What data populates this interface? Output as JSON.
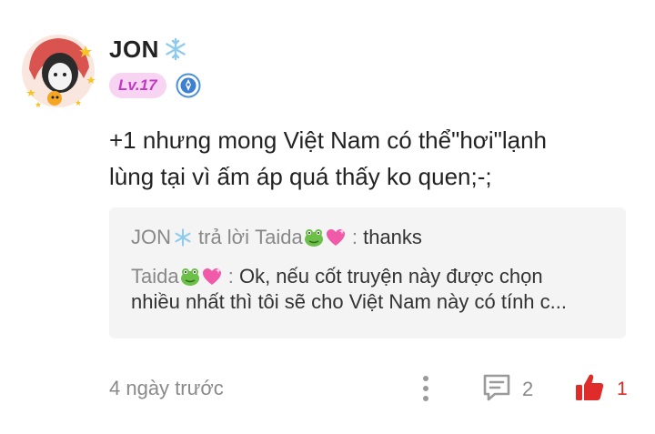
{
  "user": {
    "name": "JON",
    "level": "Lv.17"
  },
  "comment": {
    "text_line1": "+1 nhưng mong Việt Nam có thể\"hơi\"lạnh",
    "text_line2": "lùng tại vì ấm áp quá thấy ko quen;-;"
  },
  "replies": [
    {
      "author": "JON",
      "reply_to_label": "trả lời",
      "target": "Taida",
      "separator": ":",
      "text": "thanks"
    },
    {
      "author": "Taida",
      "separator": ":",
      "text_line1": "Ok, nếu cốt truyện này được chọn",
      "text_line2": "nhiều nhất thì tôi sẽ cho Việt Nam này có tính c..."
    }
  ],
  "footer": {
    "time": "4 ngày trước",
    "comment_count": "2",
    "like_count": "1"
  },
  "colors": {
    "level_badge_bg": "#f7d4f2",
    "level_badge_text": "#c238c4",
    "like_red": "#e02b2b",
    "reply_bg": "#f4f4f4",
    "muted": "#888888"
  },
  "icons": [
    "avatar",
    "snowflake-icon",
    "level-badge",
    "title-badge-icon",
    "frog-emoji",
    "heart-emoji",
    "more-icon",
    "comment-icon",
    "like-thumb-icon"
  ]
}
